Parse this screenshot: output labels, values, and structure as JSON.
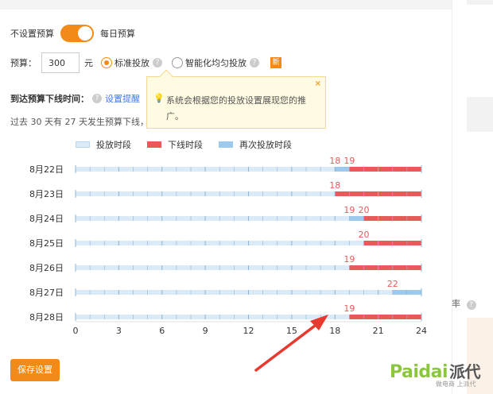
{
  "budget": {
    "no_limit_label": "不设置预算",
    "daily_label": "每日预算",
    "budget_label": "预算：",
    "budget_value": "300",
    "currency": "元",
    "standard_label": "标准投放",
    "smart_label": "智能化均匀投放",
    "new_badge": "新"
  },
  "offline": {
    "title": "到达预算下线时间：",
    "remind_link": "设置提醒",
    "summary": "过去 30 天有 27 天发生预算下线，"
  },
  "tooltip": {
    "message": "系统会根据您的投放设置展现您的推广。",
    "close": "×"
  },
  "legend": {
    "items": [
      {
        "label": "投放时段",
        "color": "#dbeaf7"
      },
      {
        "label": "下线时段",
        "color": "#e85a5a"
      },
      {
        "label": "再次投放时段",
        "color": "#9cc9ec"
      }
    ]
  },
  "chart_data": {
    "type": "bar",
    "orientation": "horizontal-timeline",
    "x_ticks": [
      "0",
      "3",
      "6",
      "9",
      "12",
      "15",
      "18",
      "21",
      "24"
    ],
    "xlim": [
      0,
      24
    ],
    "rows": [
      {
        "date": "8月22日",
        "segments": [
          {
            "from": 0,
            "to": 18,
            "kind": "on"
          },
          {
            "from": 18,
            "to": 19,
            "kind": "resume"
          },
          {
            "from": 19,
            "to": 24,
            "kind": "off"
          }
        ],
        "labels": [
          {
            "at": 18,
            "text": "18"
          },
          {
            "at": 19,
            "text": "19"
          }
        ]
      },
      {
        "date": "8月23日",
        "segments": [
          {
            "from": 0,
            "to": 18,
            "kind": "on"
          },
          {
            "from": 18,
            "to": 24,
            "kind": "off"
          }
        ],
        "labels": [
          {
            "at": 18,
            "text": "18"
          }
        ]
      },
      {
        "date": "8月24日",
        "segments": [
          {
            "from": 0,
            "to": 19,
            "kind": "on"
          },
          {
            "from": 19,
            "to": 20,
            "kind": "resume"
          },
          {
            "from": 20,
            "to": 24,
            "kind": "off"
          }
        ],
        "labels": [
          {
            "at": 19,
            "text": "19"
          },
          {
            "at": 20,
            "text": "20"
          }
        ]
      },
      {
        "date": "8月25日",
        "segments": [
          {
            "from": 0,
            "to": 20,
            "kind": "on"
          },
          {
            "from": 20,
            "to": 24,
            "kind": "off"
          }
        ],
        "labels": [
          {
            "at": 20,
            "text": "20"
          }
        ]
      },
      {
        "date": "8月26日",
        "segments": [
          {
            "from": 0,
            "to": 19,
            "kind": "on"
          },
          {
            "from": 19,
            "to": 24,
            "kind": "off"
          }
        ],
        "labels": [
          {
            "at": 19,
            "text": "19"
          }
        ]
      },
      {
        "date": "8月27日",
        "segments": [
          {
            "from": 0,
            "to": 22,
            "kind": "on"
          },
          {
            "from": 22,
            "to": 24,
            "kind": "resume"
          }
        ],
        "labels": [
          {
            "at": 22,
            "text": "22"
          }
        ]
      },
      {
        "date": "8月28日",
        "segments": [
          {
            "from": 0,
            "to": 19,
            "kind": "on"
          },
          {
            "from": 19,
            "to": 24,
            "kind": "off"
          }
        ],
        "labels": [
          {
            "at": 19,
            "text": "19"
          }
        ]
      }
    ],
    "colors": {
      "on": "#dbeaf7",
      "off": "#e85a5a",
      "resume": "#9cc9ec",
      "label": "#e85a5a",
      "arrow": "#e8392f"
    }
  },
  "actions": {
    "save_label": "保存设置"
  },
  "side": {
    "rate_label": "率"
  },
  "watermark": {
    "brand": "Paidai",
    "brand_cn": "派代",
    "slogan": "做电商 上派代"
  }
}
